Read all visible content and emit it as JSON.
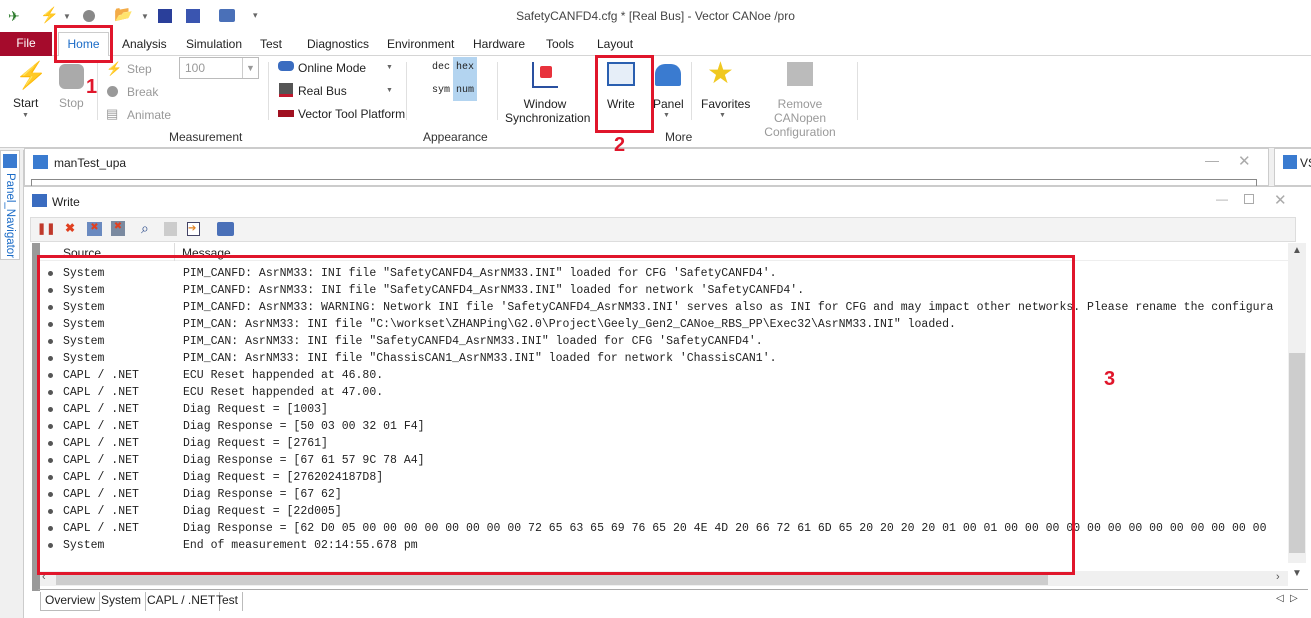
{
  "window": {
    "title": "SafetyCANFD4.cfg * [Real Bus] - Vector CANoe /pro"
  },
  "quick_access": [
    "app-icon",
    "start-icon",
    "dropdown-icon",
    "stop-icon",
    "open-folder-icon",
    "dropdown-icon",
    "save-icon",
    "save-as-icon",
    "configuration-icon",
    "customize-icon"
  ],
  "ribbon_tabs": [
    "File",
    "Home",
    "Analysis",
    "Simulation",
    "Test",
    "Diagnostics",
    "Environment",
    "Hardware",
    "Tools",
    "Layout"
  ],
  "measurement": {
    "start": "Start",
    "stop": "Stop",
    "step": "Step",
    "break": "Break",
    "animate": "Animate",
    "speed_value": "100",
    "group": "Measurement"
  },
  "mode": {
    "online": "Online Mode",
    "real_bus": "Real Bus",
    "vector_tool": "Vector Tool Platform"
  },
  "appearance": {
    "dec": "dec",
    "hex": "hex",
    "sym": "sym",
    "num": "num",
    "group": "Appearance"
  },
  "more": {
    "window_sync_1": "Window",
    "window_sync_2": "Synchronization",
    "write": "Write",
    "panel": "Panel",
    "favorites": "Favorites",
    "remove_1": "Remove CANopen",
    "remove_2": "Configuration",
    "group": "More"
  },
  "side_panel": {
    "label": "Panel_Navigator"
  },
  "mantest": {
    "title": "manTest_upa",
    "right_title": "VS"
  },
  "write_window": {
    "title": "Write",
    "columns": {
      "source": "Source",
      "message": "Message"
    },
    "rows": [
      {
        "source": "System",
        "message": "PIM_CANFD: AsrNM33: INI file \"SafetyCANFD4_AsrNM33.INI\" loaded for CFG 'SafetyCANFD4'."
      },
      {
        "source": "System",
        "message": "PIM_CANFD: AsrNM33: INI file \"SafetyCANFD4_AsrNM33.INI\" loaded for network 'SafetyCANFD4'."
      },
      {
        "source": "System",
        "message": "PIM_CANFD: AsrNM33: WARNING: Network INI file 'SafetyCANFD4_AsrNM33.INI' serves also as INI for CFG and may impact other networks. Please rename the configura"
      },
      {
        "source": "System",
        "message": "PIM_CAN: AsrNM33: INI file \"C:\\workset\\ZHANPing\\G2.0\\Project\\Geely_Gen2_CANoe_RBS_PP\\Exec32\\AsrNM33.INI\" loaded."
      },
      {
        "source": "System",
        "message": "PIM_CAN: AsrNM33: INI file \"SafetyCANFD4_AsrNM33.INI\" loaded for CFG 'SafetyCANFD4'."
      },
      {
        "source": "System",
        "message": "PIM_CAN: AsrNM33: INI file \"ChassisCAN1_AsrNM33.INI\" loaded for network 'ChassisCAN1'."
      },
      {
        "source": "CAPL / .NET",
        "message": "ECU Reset happended at 46.80."
      },
      {
        "source": "CAPL / .NET",
        "message": "ECU Reset happended at 47.00."
      },
      {
        "source": "CAPL / .NET",
        "message": "Diag Request = [1003]"
      },
      {
        "source": "CAPL / .NET",
        "message": "Diag Response = [50 03 00 32 01 F4]"
      },
      {
        "source": "CAPL / .NET",
        "message": "Diag Request = [2761]"
      },
      {
        "source": "CAPL / .NET",
        "message": "Diag Response = [67 61 57 9C 78 A4]"
      },
      {
        "source": "CAPL / .NET",
        "message": "Diag Request = [2762024187D8]"
      },
      {
        "source": "CAPL / .NET",
        "message": "Diag Response = [67 62]"
      },
      {
        "source": "CAPL / .NET",
        "message": "Diag Request = [22d005]"
      },
      {
        "source": "CAPL / .NET",
        "message": "Diag Response = [62 D0 05 00 00 00 00 00 00 00 00 72 65 63 65 69 76 65 20 4E 4D 20 66 72 61 6D 65 20 20 20 20 01 00 01 00 00 00 00 00 00 00 00 00 00 00 00 00"
      },
      {
        "source": "System",
        "message": "End of measurement 02:14:55.678 pm"
      }
    ],
    "bottom_tabs": [
      "Overview",
      "System",
      "CAPL / .NET",
      "Test"
    ]
  },
  "annotations": [
    "1",
    "2",
    "3"
  ],
  "colors": {
    "file_tab": "#a50b2c",
    "home_tab_text": "#1a6bc7",
    "annotation": "#e0162b",
    "hex_highlight": "#b3d4f0"
  }
}
